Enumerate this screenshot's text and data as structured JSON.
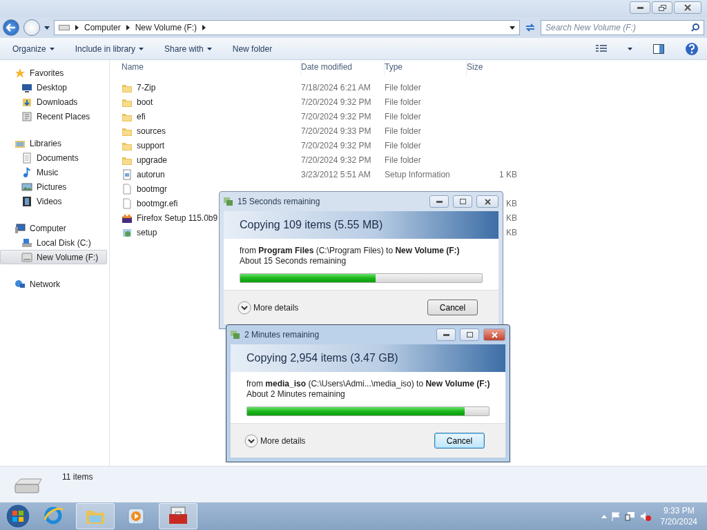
{
  "address_bar": {
    "path": [
      "Computer",
      "New Volume (F:)"
    ]
  },
  "search": {
    "placeholder": "Search New Volume (F:)"
  },
  "toolbar": {
    "items": [
      {
        "label": "Organize",
        "dropdown": true
      },
      {
        "label": "Include in library",
        "dropdown": true
      },
      {
        "label": "Share with",
        "dropdown": true
      },
      {
        "label": "New folder",
        "dropdown": false
      }
    ]
  },
  "nav_pane": {
    "groups": [
      {
        "label": "Favorites",
        "kind": "star",
        "children": [
          {
            "label": "Desktop",
            "kind": "desktop",
            "selected": false
          },
          {
            "label": "Downloads",
            "kind": "downloads",
            "selected": false
          },
          {
            "label": "Recent Places",
            "kind": "recent",
            "selected": false
          }
        ]
      },
      {
        "label": "Libraries",
        "kind": "library",
        "children": [
          {
            "label": "Documents",
            "kind": "document",
            "selected": false
          },
          {
            "label": "Music",
            "kind": "music",
            "selected": false
          },
          {
            "label": "Pictures",
            "kind": "pictures",
            "selected": false
          },
          {
            "label": "Videos",
            "kind": "video",
            "selected": false
          }
        ]
      },
      {
        "label": "Computer",
        "kind": "computer",
        "children": [
          {
            "label": "Local Disk (C:)",
            "kind": "disk",
            "selected": false
          },
          {
            "label": "New Volume (F:)",
            "kind": "drive",
            "selected": true
          }
        ]
      },
      {
        "label": "Network",
        "kind": "network"
      }
    ]
  },
  "table": {
    "columns": [
      "Name",
      "Date modified",
      "Type",
      "Size"
    ],
    "rows": [
      {
        "kind": "folder",
        "name": "7-Zip",
        "date": "7/18/2024 6:21 AM",
        "type": "File folder"
      },
      {
        "kind": "folder",
        "name": "boot",
        "date": "7/20/2024 9:32 PM",
        "type": "File folder"
      },
      {
        "kind": "folder",
        "name": "efi",
        "date": "7/20/2024 9:32 PM",
        "type": "File folder"
      },
      {
        "kind": "folder",
        "name": "sources",
        "date": "7/20/2024 9:33 PM",
        "type": "File folder"
      },
      {
        "kind": "folder",
        "name": "support",
        "date": "7/20/2024 9:32 PM",
        "type": "File folder"
      },
      {
        "kind": "folder",
        "name": "upgrade",
        "date": "7/20/2024 9:32 PM",
        "type": "File folder"
      },
      {
        "kind": "setupinfo",
        "name": "autorun",
        "date": "3/23/2012 5:51 AM",
        "type": "Setup Information",
        "size": "1 KB"
      },
      {
        "kind": "file",
        "name": "bootmgr"
      },
      {
        "kind": "file",
        "name": "bootmgr.efi",
        "size": "KB"
      },
      {
        "kind": "installer",
        "name": "Firefox Setup 115.0b9",
        "size": "KB"
      },
      {
        "kind": "setup",
        "name": "setup",
        "size": "KB"
      }
    ]
  },
  "status_bar": {
    "count": "11 items"
  },
  "dialogs": [
    {
      "title": "15 Seconds remaining",
      "heading": "Copying 109 items (5.55 MB)",
      "from": "from **Program Files** (C:\\Program Files) to **New Volume (F:)**",
      "remaining": "About 15 Seconds remaining",
      "level": 0.56,
      "details": "More details",
      "cancel": "Cancel",
      "active": false
    },
    {
      "title": "2 Minutes remaining",
      "heading": "Copying 2,954 items (3.47 GB)",
      "from": "from **media_iso** (C:\\Users\\Admi...\\media_iso)  to **New Volume (F:)**",
      "remaining": "About 2 Minutes remaining",
      "level": 0.9,
      "details": "More details",
      "cancel": "Cancel",
      "active": true
    }
  ],
  "taskbar": {
    "apps": [
      {
        "kind": "browser",
        "selected": false
      },
      {
        "kind": "explorer",
        "selected": true
      },
      {
        "kind": "player",
        "selected": false
      },
      {
        "kind": "toolbox",
        "selected": true
      }
    ]
  },
  "clock": {
    "time": "9:33 PM",
    "date": "7/20/2024"
  }
}
